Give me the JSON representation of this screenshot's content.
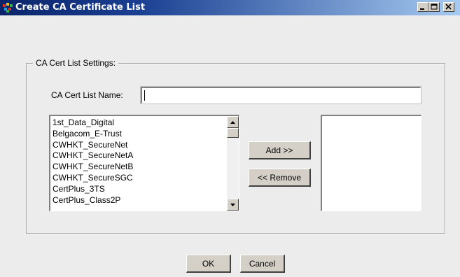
{
  "window": {
    "title": "Create CA Certificate List",
    "app_icon": "app-logo-icon",
    "controls": [
      "minimize-icon",
      "maximize-icon",
      "close-icon"
    ]
  },
  "settings_group": {
    "label": "CA Cert List Settings:"
  },
  "name_field": {
    "label": "CA Cert List Name:",
    "value": ""
  },
  "available_list": {
    "items": [
      "1st_Data_Digital",
      "Belgacom_E-Trust",
      "CWHKT_SecureNet",
      "CWHKT_SecureNetA",
      "CWHKT_SecureNetB",
      "CWHKT_SecureSGC",
      "CertPlus_3TS",
      "CertPlus_Class2P"
    ]
  },
  "buttons": {
    "add": "Add >>",
    "remove": "<< Remove",
    "ok": "OK",
    "cancel": "Cancel"
  },
  "colors": {
    "titlebar_start": "#0a246a",
    "titlebar_end": "#a6caf0",
    "dialog_bg": "#ececec",
    "button_face": "#d4d0c8"
  }
}
